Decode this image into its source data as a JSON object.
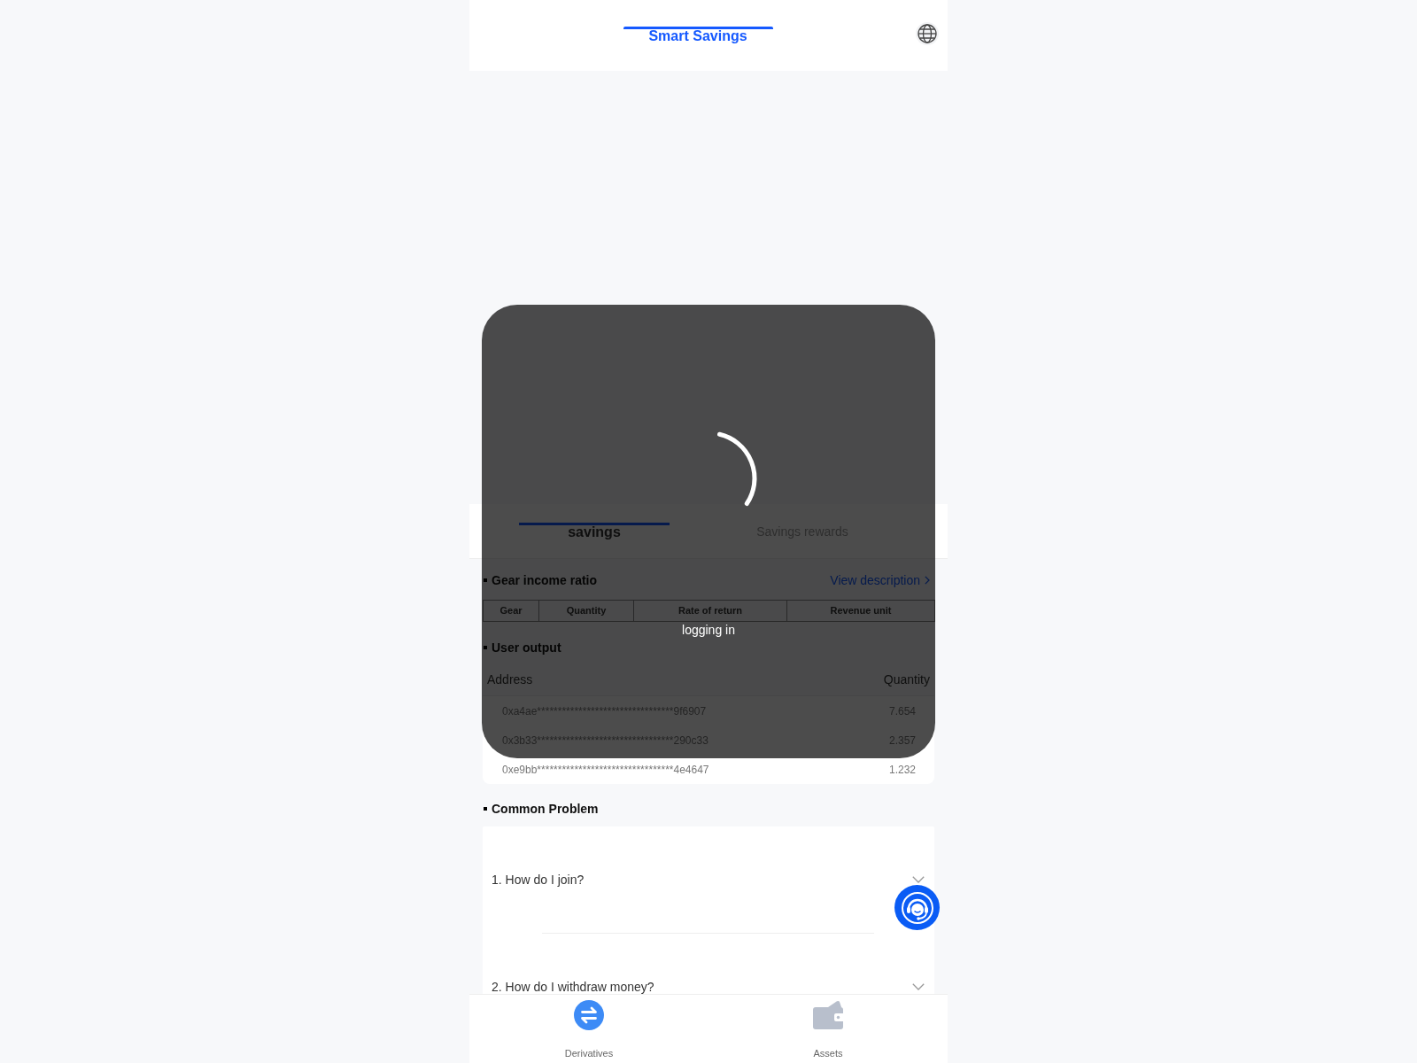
{
  "header": {
    "tabs": [
      {
        "label": "Smart Savings",
        "selected": true
      }
    ]
  },
  "savings_tabs": [
    {
      "label": "savings",
      "selected": true
    },
    {
      "label": "Savings rewards",
      "selected": false
    }
  ],
  "gear_income_ratio": {
    "title": "Gear income ratio",
    "link": "View description",
    "table": {
      "columns": [
        "Gear",
        "Quantity",
        "Rate of return",
        "Revenue unit"
      ]
    }
  },
  "user_output": {
    "title": "User output",
    "columns": [
      "Address",
      "Quantity"
    ],
    "rows": [
      {
        "address": "0xa4ae*********************************9f6907",
        "quantity": "7.654"
      },
      {
        "address": "0x3b33*********************************290c33",
        "quantity": "2.357"
      },
      {
        "address": "0xe9bb*********************************4e4647",
        "quantity": "1.232"
      }
    ]
  },
  "common_problem": {
    "title": "Common Problem",
    "items": [
      {
        "question": "1. How do I join?",
        "expanded": false
      },
      {
        "question": "2. How do I withdraw money?",
        "expanded": false
      }
    ]
  },
  "bottom_nav": {
    "items": [
      {
        "label": "Derivatives",
        "selected": true
      },
      {
        "label": "Assets",
        "selected": false
      }
    ]
  },
  "loading": {
    "text": "logging in"
  }
}
